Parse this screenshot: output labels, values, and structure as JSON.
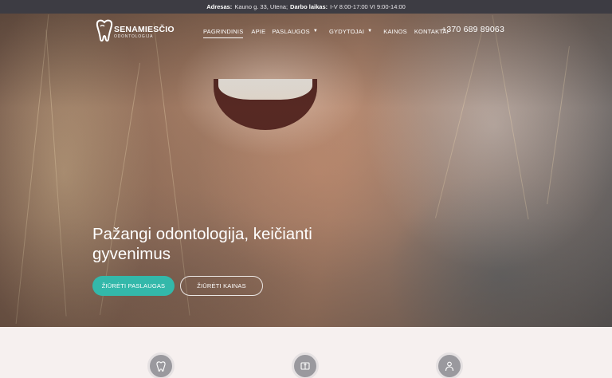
{
  "topbar": {
    "address_label": "Adresas:",
    "address_value": "Kauno g. 33, Utena;",
    "hours_label": "Darbo laikas:",
    "hours_value": "I-V 8:00-17:00 VI 9:00-14:00"
  },
  "brand": {
    "name": "SENAMIESČIO",
    "tagline": "ODONTOLOGIJA"
  },
  "nav": {
    "items": [
      {
        "label": "PAGRINDINIS",
        "active": true,
        "has_dropdown": false
      },
      {
        "label": "APIE",
        "active": false,
        "has_dropdown": false
      },
      {
        "label": "PASLAUGOS",
        "active": false,
        "has_dropdown": true
      },
      {
        "label": "GYDYTOJAI",
        "active": false,
        "has_dropdown": true
      },
      {
        "label": "KAINOS",
        "active": false,
        "has_dropdown": false
      },
      {
        "label": "KONTAKTAI",
        "active": false,
        "has_dropdown": false
      }
    ],
    "phone": "+370 689 89063"
  },
  "hero": {
    "headline_line1": "Pažangi odontologija, keičianti",
    "headline_line2": "gyvenimus",
    "primary_button": "ŽIŪRĖTI PASLAUGAS",
    "secondary_button": "ŽIŪRĖTI KAINAS"
  },
  "features": {
    "icons": [
      "tooth-icon",
      "book-icon",
      "doctor-icon"
    ]
  },
  "colors": {
    "accent": "#33b8aa",
    "topbar_bg": "#3d3c43",
    "section_bg": "#f6f0ef",
    "icon_circle": "#9a999e"
  }
}
